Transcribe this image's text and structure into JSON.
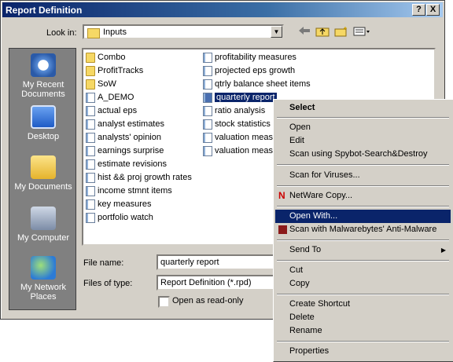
{
  "dialog": {
    "title": "Report Definition",
    "help_btn": "?",
    "close_btn": "X"
  },
  "lookin": {
    "label": "Look in:",
    "value": "Inputs"
  },
  "toolbar": {
    "icons": [
      "back-arrow-icon",
      "up-folder-icon",
      "new-folder-icon",
      "view-menu-icon"
    ]
  },
  "places": [
    {
      "label": "My Recent Documents",
      "icon": "recent-documents-icon"
    },
    {
      "label": "Desktop",
      "icon": "desktop-icon"
    },
    {
      "label": "My Documents",
      "icon": "my-documents-icon"
    },
    {
      "label": "My Computer",
      "icon": "my-computer-icon"
    },
    {
      "label": "My Network Places",
      "icon": "network-places-icon"
    }
  ],
  "files": {
    "col1": [
      {
        "name": "Combo",
        "type": "folder"
      },
      {
        "name": "ProfitTracks",
        "type": "folder"
      },
      {
        "name": "SoW",
        "type": "folder"
      },
      {
        "name": "A_DEMO",
        "type": "doc"
      },
      {
        "name": "actual eps",
        "type": "doc"
      },
      {
        "name": "analyst estimates",
        "type": "doc"
      },
      {
        "name": "analysts' opinion",
        "type": "doc"
      },
      {
        "name": "earnings surprise",
        "type": "doc"
      },
      {
        "name": "estimate revisions",
        "type": "doc"
      },
      {
        "name": "hist && proj growth rates",
        "type": "doc"
      },
      {
        "name": "income stmnt items",
        "type": "doc"
      },
      {
        "name": "key measures",
        "type": "doc"
      },
      {
        "name": "portfolio watch",
        "type": "doc"
      }
    ],
    "col2": [
      {
        "name": "profitability measures",
        "type": "doc"
      },
      {
        "name": "projected eps growth",
        "type": "doc"
      },
      {
        "name": "qtrly balance sheet items",
        "type": "doc"
      },
      {
        "name": "quarterly report",
        "type": "doc",
        "selected": true
      },
      {
        "name": "ratio analysis",
        "type": "doc"
      },
      {
        "name": "stock statistics",
        "type": "doc"
      },
      {
        "name": "valuation measu",
        "type": "doc"
      },
      {
        "name": "valuation measu",
        "type": "doc"
      }
    ]
  },
  "form": {
    "filename_label": "File name:",
    "filename_value": "quarterly report",
    "filetype_label": "Files of type:",
    "filetype_value": "Report Definition (*.rpd)",
    "readonly_label": "Open as read-only"
  },
  "context_menu": {
    "items": [
      {
        "label": "Select",
        "bold": true
      },
      {
        "sep": true
      },
      {
        "label": "Open"
      },
      {
        "label": "Edit"
      },
      {
        "label": "Scan using Spybot-Search&Destroy"
      },
      {
        "sep": true
      },
      {
        "label": "Scan for Viruses..."
      },
      {
        "sep": true
      },
      {
        "label": "NetWare Copy...",
        "icon": "netware-icon"
      },
      {
        "sep": true
      },
      {
        "label": "Open With...",
        "highlighted": true
      },
      {
        "label": "Scan with Malwarebytes' Anti-Malware",
        "icon": "malwarebytes-icon"
      },
      {
        "sep": true
      },
      {
        "label": "Send To",
        "submenu": true
      },
      {
        "sep": true
      },
      {
        "label": "Cut"
      },
      {
        "label": "Copy"
      },
      {
        "sep": true
      },
      {
        "label": "Create Shortcut"
      },
      {
        "label": "Delete"
      },
      {
        "label": "Rename"
      },
      {
        "sep": true
      },
      {
        "label": "Properties"
      }
    ]
  },
  "colors": {
    "title_bar": "#0a246a",
    "highlight": "#0a246a",
    "face": "#d4d0c8",
    "places_bg": "#808080"
  }
}
